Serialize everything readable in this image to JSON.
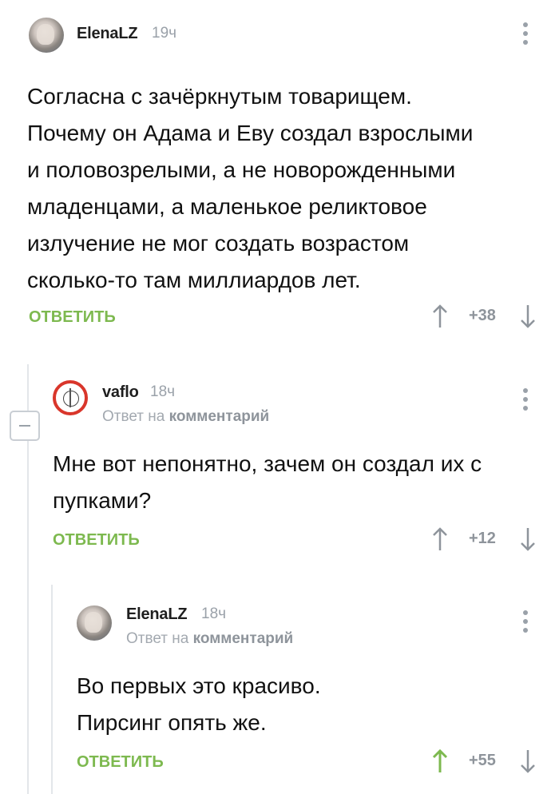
{
  "comments": [
    {
      "author": "ElenaLZ",
      "time": "19ч",
      "reply_prefix": "",
      "reply_target": "",
      "lines": [
        "Согласна с зачёркнутым товарищем.",
        "Почему он Адама и Еву создал взрослыми",
        "и половозрелыми, а не новорожденными",
        "младенцами, а маленькое реликтовое",
        "излучение не мог создать возрастом",
        "сколько-то там миллиардов лет."
      ],
      "reply_label": "ОТВЕТИТЬ",
      "score": "+38",
      "avatar": "elena-avatar",
      "upvoted": false
    },
    {
      "author": "vaflo",
      "time": "18ч",
      "reply_prefix": "Ответ на",
      "reply_target": "комментарий",
      "lines": [
        "Мне вот непонятно, зачем он создал их с",
        "пупками?"
      ],
      "reply_label": "ОТВЕТИТЬ",
      "score": "+12",
      "avatar": "vaflo-avatar",
      "upvoted": false
    },
    {
      "author": "ElenaLZ",
      "time": "18ч",
      "reply_prefix": "Ответ на",
      "reply_target": "комментарий",
      "lines": [
        "Во первых это красиво.",
        "Пирсинг опять же."
      ],
      "reply_label": "ОТВЕТИТЬ",
      "score": "+55",
      "avatar": "elena-avatar",
      "upvoted": true
    }
  ],
  "colors": {
    "accent_green": "#7db94f",
    "muted": "#9aa1a9",
    "thread_line": "#e3e6ea"
  }
}
